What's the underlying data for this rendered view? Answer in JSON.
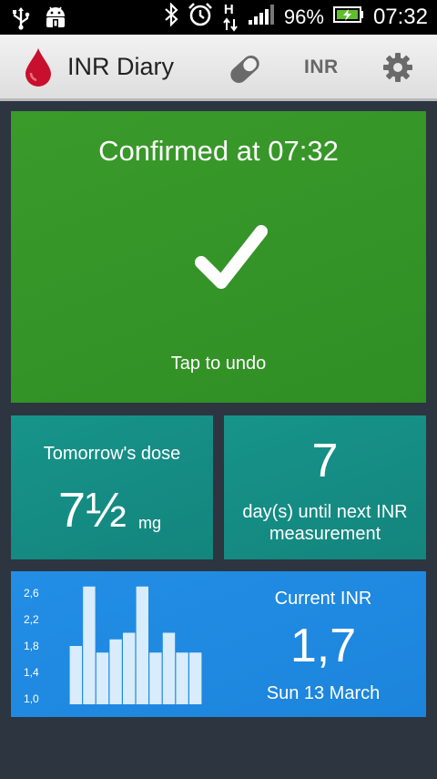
{
  "status_bar": {
    "battery": "96%",
    "time": "07:32",
    "network_letter": "H",
    "icons": [
      "usb-icon",
      "android-debug-icon",
      "bluetooth-icon",
      "alarm-icon",
      "data-arrows-icon",
      "signal-icon",
      "battery-icon"
    ]
  },
  "app_bar": {
    "title": "INR Diary",
    "inr_button": "INR",
    "icons": [
      "blood-drop-icon",
      "pill-icon",
      "gear-icon"
    ],
    "drop_color": "#c8102e"
  },
  "confirm_tile": {
    "title": "Confirmed at 07:32",
    "action": "Tap to undo",
    "color": "#33932a"
  },
  "dose_tile": {
    "title": "Tomorrow's dose",
    "value": "7½",
    "unit": "mg",
    "color": "#168f86"
  },
  "days_tile": {
    "value": "7",
    "label": "day(s) until next INR measurement",
    "color": "#168f86"
  },
  "inr_tile": {
    "label": "Current INR",
    "value": "1,7",
    "date": "Sun 13 March",
    "color": "#2089e0"
  },
  "chart_data": {
    "type": "bar",
    "y_ticks": [
      "2,6",
      "2,2",
      "1,8",
      "1,4",
      "1,0"
    ],
    "ylim": [
      1.0,
      2.6
    ],
    "values": [
      1.8,
      2.7,
      1.7,
      1.9,
      2.0,
      2.7,
      1.7,
      2.0,
      1.7,
      1.7
    ],
    "bar_color": "#d8ecfb"
  }
}
